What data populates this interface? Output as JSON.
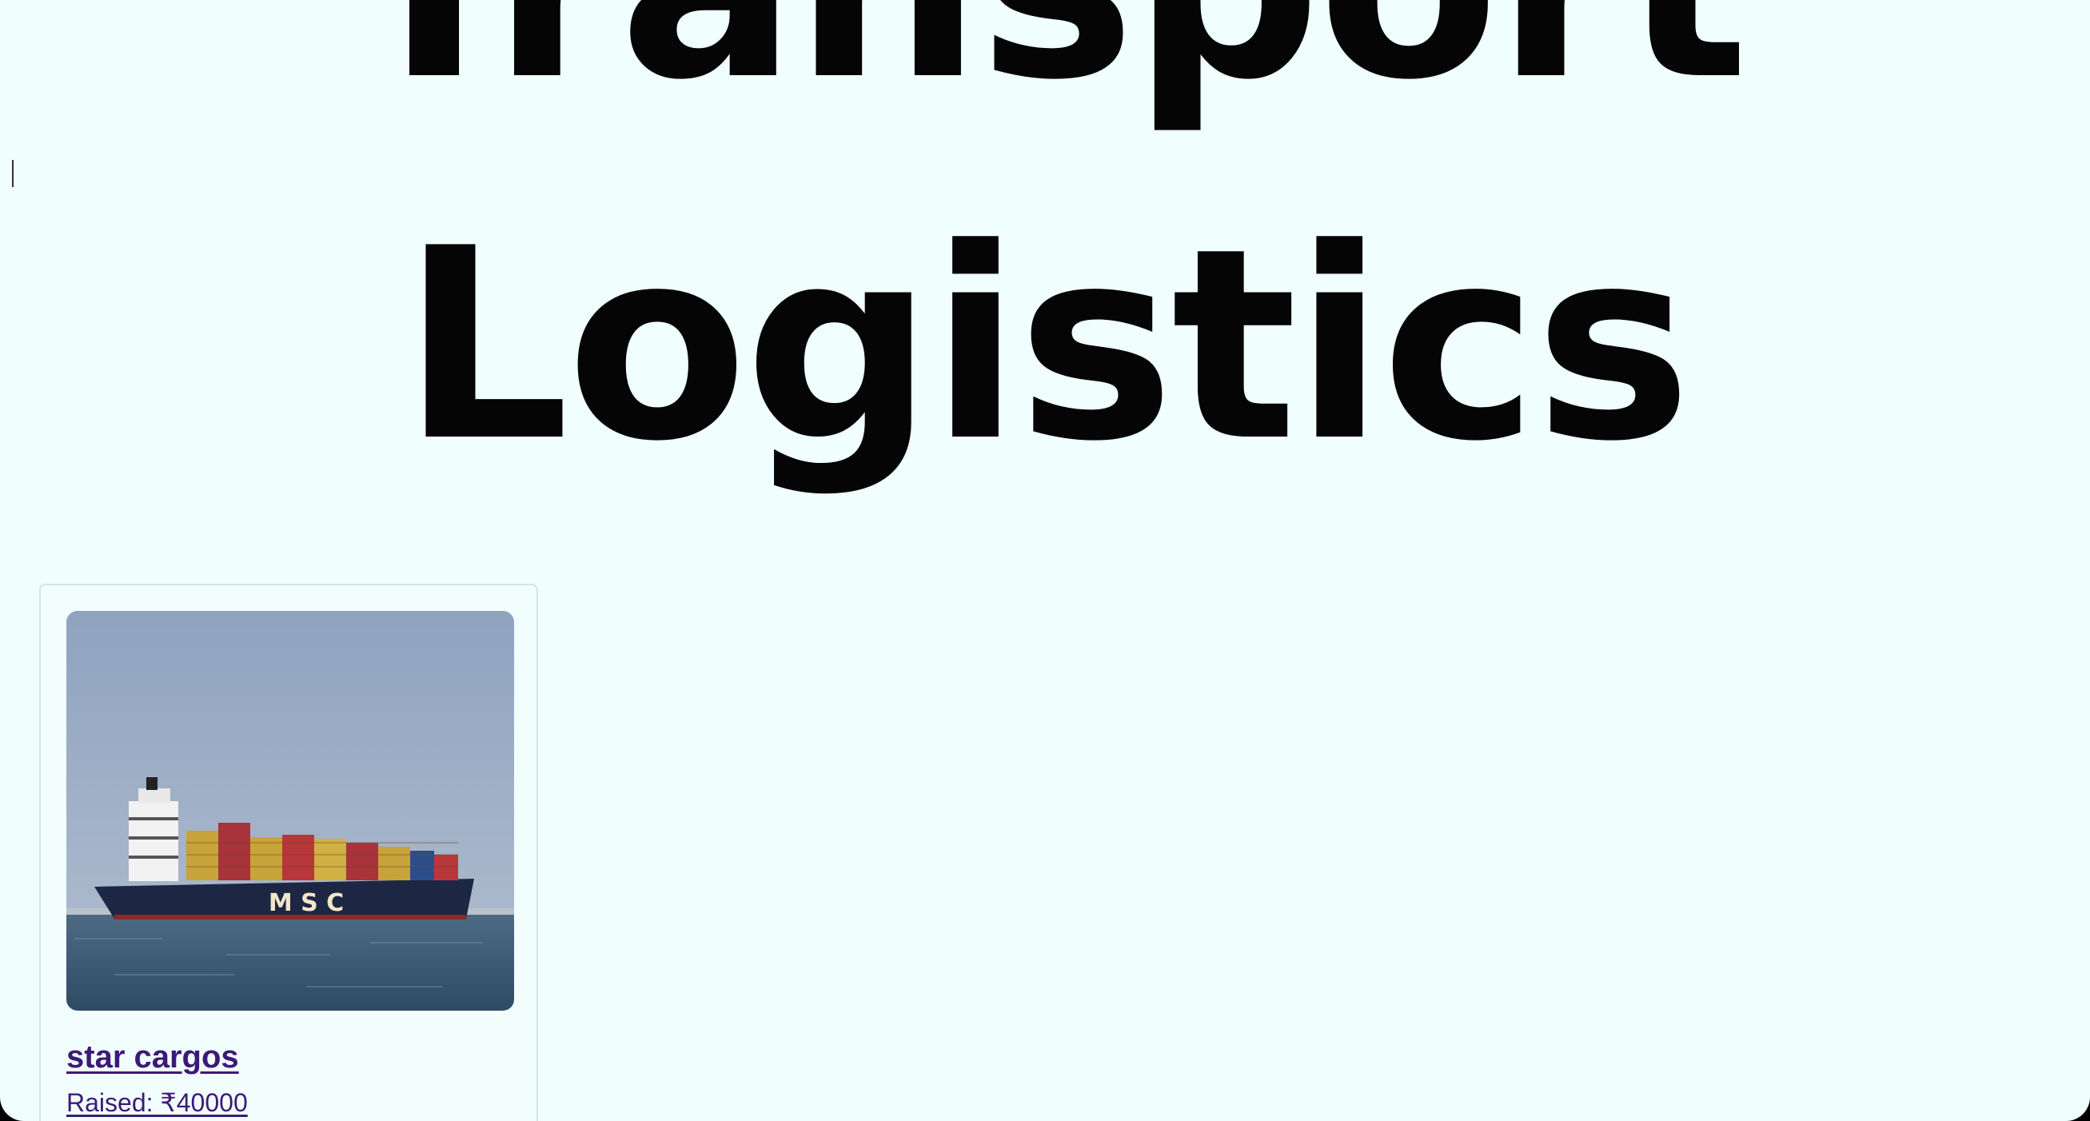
{
  "hero": {
    "line1": "Transport",
    "line2": "Logistics"
  },
  "card": {
    "image_alt": "Container ship at sea",
    "ship_lettering": "M S C",
    "title": "star cargos",
    "raised_label": "Raised: ₹40000"
  },
  "colors": {
    "page_background": "#f1fefe",
    "hero_text": "#050505",
    "link": "#3c1a78"
  }
}
